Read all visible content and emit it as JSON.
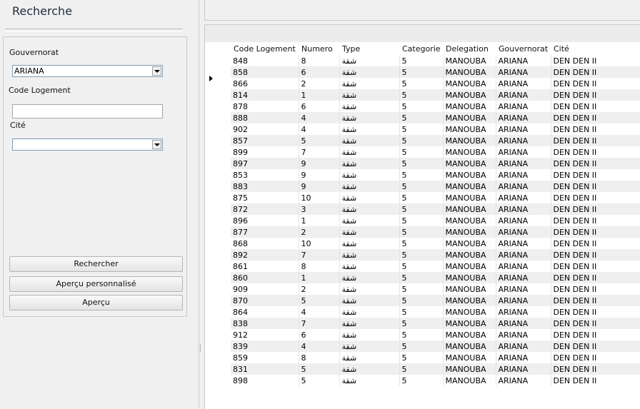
{
  "search_panel": {
    "title": "Recherche",
    "gouvernorat_label": "Gouvernorat",
    "gouvernorat_value": "ARIANA",
    "code_logement_label": "Code Logement",
    "code_logement_value": "",
    "cite_label": "Cité",
    "cite_value": "",
    "buttons": {
      "rechercher": "Rechercher",
      "apercu_personnalise": "Aperçu personnalisé",
      "apercu": "Aperçu"
    }
  },
  "grid": {
    "columns": [
      "Code Logement",
      "Numero",
      "Type",
      "Categorie",
      "Delegation",
      "Gouvernorat",
      "Cité"
    ],
    "rows": [
      [
        "848",
        "8",
        "شقة",
        "5",
        "MANOUBA",
        "ARIANA",
        "DEN DEN II"
      ],
      [
        "858",
        "6",
        "شقة",
        "5",
        "MANOUBA",
        "ARIANA",
        "DEN DEN II"
      ],
      [
        "866",
        "2",
        "شقة",
        "5",
        "MANOUBA",
        "ARIANA",
        "DEN DEN II"
      ],
      [
        "814",
        "1",
        "شقة",
        "5",
        "MANOUBA",
        "ARIANA",
        "DEN DEN II"
      ],
      [
        "878",
        "6",
        "شقة",
        "5",
        "MANOUBA",
        "ARIANA",
        "DEN DEN II"
      ],
      [
        "888",
        "4",
        "شقة",
        "5",
        "MANOUBA",
        "ARIANA",
        "DEN DEN II"
      ],
      [
        "902",
        "4",
        "شقة",
        "5",
        "MANOUBA",
        "ARIANA",
        "DEN DEN II"
      ],
      [
        "857",
        "5",
        "شقة",
        "5",
        "MANOUBA",
        "ARIANA",
        "DEN DEN II"
      ],
      [
        "899",
        "7",
        "شقة",
        "5",
        "MANOUBA",
        "ARIANA",
        "DEN DEN II"
      ],
      [
        "897",
        "9",
        "شقة",
        "5",
        "MANOUBA",
        "ARIANA",
        "DEN DEN II"
      ],
      [
        "853",
        "9",
        "شقة",
        "5",
        "MANOUBA",
        "ARIANA",
        "DEN DEN II"
      ],
      [
        "883",
        "9",
        "شقة",
        "5",
        "MANOUBA",
        "ARIANA",
        "DEN DEN II"
      ],
      [
        "875",
        "10",
        "شقة",
        "5",
        "MANOUBA",
        "ARIANA",
        "DEN DEN II"
      ],
      [
        "872",
        "3",
        "شقة",
        "5",
        "MANOUBA",
        "ARIANA",
        "DEN DEN II"
      ],
      [
        "896",
        "1",
        "شقة",
        "5",
        "MANOUBA",
        "ARIANA",
        "DEN DEN II"
      ],
      [
        "877",
        "2",
        "شقة",
        "5",
        "MANOUBA",
        "ARIANA",
        "DEN DEN II"
      ],
      [
        "868",
        "10",
        "شقة",
        "5",
        "MANOUBA",
        "ARIANA",
        "DEN DEN II"
      ],
      [
        "892",
        "7",
        "شقة",
        "5",
        "MANOUBA",
        "ARIANA",
        "DEN DEN II"
      ],
      [
        "861",
        "8",
        "شقة",
        "5",
        "MANOUBA",
        "ARIANA",
        "DEN DEN II"
      ],
      [
        "860",
        "1",
        "شقة",
        "5",
        "MANOUBA",
        "ARIANA",
        "DEN DEN II"
      ],
      [
        "909",
        "2",
        "شقة",
        "5",
        "MANOUBA",
        "ARIANA",
        "DEN DEN II"
      ],
      [
        "870",
        "5",
        "شقة",
        "5",
        "MANOUBA",
        "ARIANA",
        "DEN DEN II"
      ],
      [
        "864",
        "4",
        "شقة",
        "5",
        "MANOUBA",
        "ARIANA",
        "DEN DEN II"
      ],
      [
        "838",
        "7",
        "شقة",
        "5",
        "MANOUBA",
        "ARIANA",
        "DEN DEN II"
      ],
      [
        "912",
        "6",
        "شقة",
        "5",
        "MANOUBA",
        "ARIANA",
        "DEN DEN II"
      ],
      [
        "839",
        "4",
        "شقة",
        "5",
        "MANOUBA",
        "ARIANA",
        "DEN DEN II"
      ],
      [
        "859",
        "8",
        "شقة",
        "5",
        "MANOUBA",
        "ARIANA",
        "DEN DEN II"
      ],
      [
        "831",
        "5",
        "شقة",
        "5",
        "MANOUBA",
        "ARIANA",
        "DEN DEN II"
      ],
      [
        "898",
        "5",
        "شقة",
        "5",
        "MANOUBA",
        "ARIANA",
        "DEN DEN II"
      ]
    ]
  }
}
